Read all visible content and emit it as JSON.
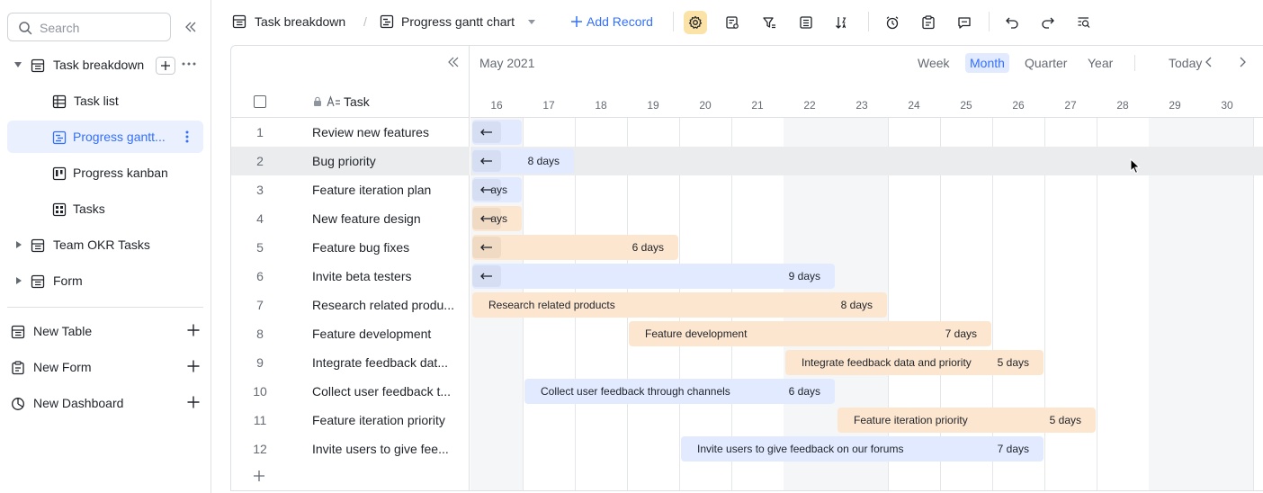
{
  "search": {
    "placeholder": "Search"
  },
  "sidebar": {
    "items": [
      {
        "label": "Task breakdown"
      },
      {
        "label": "Task list"
      },
      {
        "label": "Progress gantt..."
      },
      {
        "label": "Progress kanban"
      },
      {
        "label": "Tasks"
      },
      {
        "label": "Team OKR Tasks"
      },
      {
        "label": "Form"
      }
    ],
    "bottom": [
      {
        "label": "New Table"
      },
      {
        "label": "New Form"
      },
      {
        "label": "New Dashboard"
      }
    ]
  },
  "toolbar": {
    "table_name": "Task breakdown",
    "separator": "/",
    "view_name": "Progress gantt chart",
    "add_record": "Add Record"
  },
  "grid": {
    "column_header": "Task",
    "rows": [
      {
        "num": "1",
        "task": "Review new features"
      },
      {
        "num": "2",
        "task": "Bug priority"
      },
      {
        "num": "3",
        "task": "Feature iteration plan"
      },
      {
        "num": "4",
        "task": "New feature design"
      },
      {
        "num": "5",
        "task": "Feature bug fixes"
      },
      {
        "num": "6",
        "task": "Invite beta testers"
      },
      {
        "num": "7",
        "task": "Research related produ..."
      },
      {
        "num": "8",
        "task": "Feature development"
      },
      {
        "num": "9",
        "task": "Integrate feedback dat..."
      },
      {
        "num": "10",
        "task": "Collect user feedback t..."
      },
      {
        "num": "11",
        "task": "Feature iteration priority"
      },
      {
        "num": "12",
        "task": "Invite users to give fee..."
      }
    ]
  },
  "gantt": {
    "month": "May 2021",
    "periods": [
      "Week",
      "Month",
      "Quarter",
      "Year"
    ],
    "selected_period": "Month",
    "today": "Today",
    "days": [
      "16",
      "17",
      "18",
      "19",
      "20",
      "21",
      "22",
      "23",
      "24",
      "25",
      "26",
      "27",
      "28",
      "29",
      "30"
    ],
    "weekend_days": [
      "22",
      "23",
      "29",
      "30"
    ],
    "bars": [
      {
        "row": 0,
        "start": "16",
        "end": "16",
        "color": "blue",
        "label": "",
        "duration": "",
        "arrow": true
      },
      {
        "row": 1,
        "start": "16",
        "end": "17",
        "color": "blue",
        "label": "",
        "duration": "8 days",
        "arrow": true
      },
      {
        "row": 2,
        "start": "16",
        "end": "16",
        "color": "blue",
        "label": "",
        "duration": "ays",
        "arrow": true
      },
      {
        "row": 3,
        "start": "16",
        "end": "16",
        "color": "orange",
        "label": "",
        "duration": "ays",
        "arrow": true
      },
      {
        "row": 4,
        "start": "16",
        "end": "19",
        "color": "orange",
        "label": "",
        "duration": "6 days",
        "arrow": true
      },
      {
        "row": 5,
        "start": "16",
        "end": "22",
        "color": "blue",
        "label": "",
        "duration": "9 days",
        "arrow": true
      },
      {
        "row": 6,
        "start": "16",
        "end": "23",
        "color": "orange",
        "label": "Research related products",
        "duration": "8 days",
        "arrow": false
      },
      {
        "row": 7,
        "start": "19",
        "end": "25",
        "color": "orange",
        "label": "Feature development",
        "duration": "7 days",
        "arrow": false
      },
      {
        "row": 8,
        "start": "22",
        "end": "26",
        "color": "orange",
        "label": "Integrate feedback data and priority",
        "duration": "5 days",
        "arrow": false
      },
      {
        "row": 9,
        "start": "17",
        "end": "22",
        "color": "blue",
        "label": "Collect user feedback through channels",
        "duration": "6 days",
        "arrow": false
      },
      {
        "row": 10,
        "start": "23",
        "end": "27",
        "color": "orange",
        "label": "Feature iteration priority",
        "duration": "5 days",
        "arrow": false
      },
      {
        "row": 11,
        "start": "20",
        "end": "26",
        "color": "blue",
        "label": "Invite users to give feedback on our forums",
        "duration": "7 days",
        "arrow": false
      }
    ],
    "highlighted_row": 1
  },
  "colors": {
    "accent": "#3370ff",
    "bar_blue": "#e1eaff",
    "bar_orange": "#fde6cf",
    "active_view": "#eaf0fd",
    "settings_active": "#fbe2a6"
  }
}
